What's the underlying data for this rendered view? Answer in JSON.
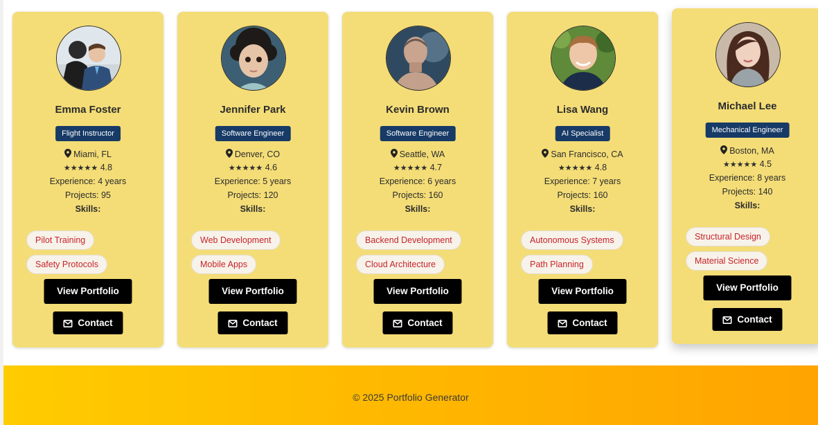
{
  "cards": [
    {
      "name": "Emma Foster",
      "role": "Flight Instructor",
      "location": "Miami, FL",
      "stars": "★★★★★",
      "rating": "4.8",
      "experience": "Experience: 4 years",
      "projects": "Projects: 95",
      "skills_label": "Skills:",
      "skills": [
        "Pilot Training",
        "Safety Protocols"
      ],
      "portfolio_label": "View Portfolio",
      "contact_label": "Contact"
    },
    {
      "name": "Jennifer Park",
      "role": "Software Engineer",
      "location": "Denver, CO",
      "stars": "★★★★★",
      "rating": "4.6",
      "experience": "Experience: 5 years",
      "projects": "Projects: 120",
      "skills_label": "Skills:",
      "skills": [
        "Web Development",
        "Mobile Apps"
      ],
      "portfolio_label": "View Portfolio",
      "contact_label": "Contact"
    },
    {
      "name": "Kevin Brown",
      "role": "Software Engineer",
      "location": "Seattle, WA",
      "stars": "★★★★★",
      "rating": "4.7",
      "experience": "Experience: 6 years",
      "projects": "Projects: 160",
      "skills_label": "Skills:",
      "skills": [
        "Backend Development",
        "Cloud Architecture"
      ],
      "portfolio_label": "View Portfolio",
      "contact_label": "Contact"
    },
    {
      "name": "Lisa Wang",
      "role": "AI Specialist",
      "location": "San Francisco, CA",
      "stars": "★★★★★",
      "rating": "4.8",
      "experience": "Experience: 7 years",
      "projects": "Projects: 160",
      "skills_label": "Skills:",
      "skills": [
        "Autonomous Systems",
        "Path Planning"
      ],
      "portfolio_label": "View Portfolio",
      "contact_label": "Contact"
    },
    {
      "name": "Michael Lee",
      "role": "Mechanical Engineer",
      "location": "Boston, MA",
      "stars": "★★★★★",
      "rating": "4.5",
      "experience": "Experience: 8 years",
      "projects": "Projects: 140",
      "skills_label": "Skills:",
      "skills": [
        "Structural Design",
        "Material Science"
      ],
      "portfolio_label": "View Portfolio",
      "contact_label": "Contact"
    }
  ],
  "footer": {
    "copyright": "© 2025 Portfolio Generator"
  },
  "colors": {
    "card_bg": "#f4dd77",
    "role_badge": "#173a66",
    "skill_text": "#c8222a",
    "button_bg": "#000000",
    "footer_start": "#ffcc00",
    "footer_end": "#ffa400"
  },
  "icons": {
    "location": "map-pin-icon",
    "contact": "envelope-icon"
  }
}
